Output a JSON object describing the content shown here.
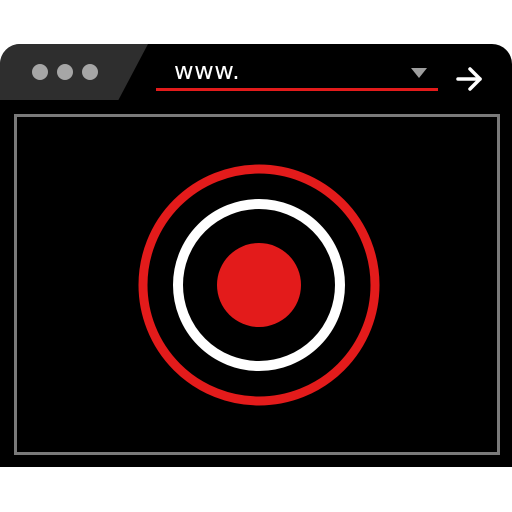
{
  "address_bar": {
    "url_text": "www.",
    "dropdown_icon": "chevron-down-icon",
    "go_icon": "arrow-right-icon"
  },
  "window_controls": {
    "icon": "window-dots-icon"
  },
  "content": {
    "icon": "record-icon",
    "colors": {
      "outer_ring": "#e31b1b",
      "inner_ring": "#ffffff",
      "center_dot": "#e31b1b",
      "background": "#000000"
    }
  }
}
